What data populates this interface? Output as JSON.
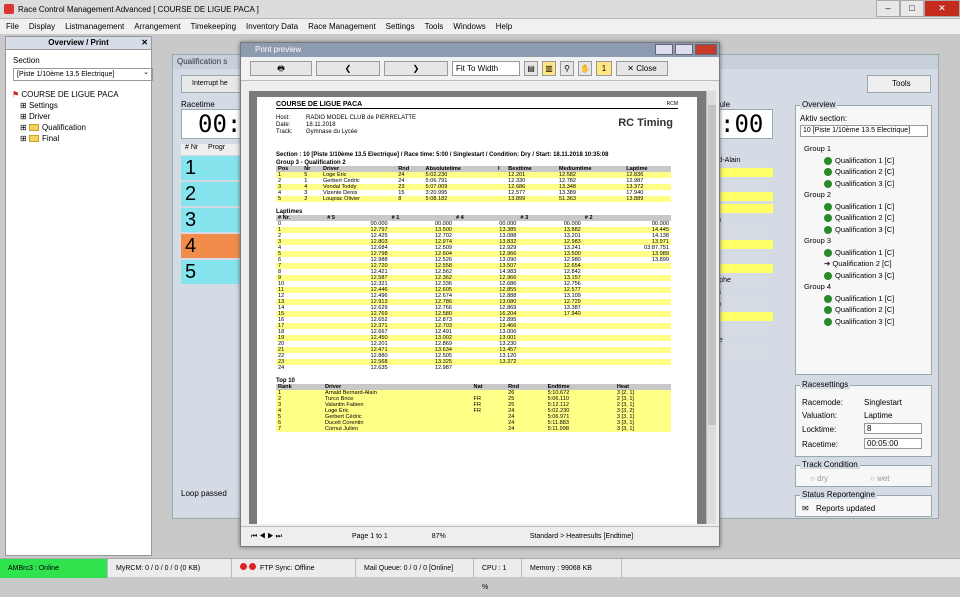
{
  "app": {
    "title": "Race Control Management Advanced [ COURSE DE LIGUE PACA ]"
  },
  "menu": [
    "File",
    "Display",
    "Listmanagement",
    "Arrangement",
    "Timekeeping",
    "Inventory Data",
    "Race Management",
    "Settings",
    "Tools",
    "Windows",
    "Help"
  ],
  "left": {
    "title": "Overview / Print",
    "section_label": "Section",
    "section_value": "[Piste 1/10ème 13.5 Electrique]",
    "tree": [
      "COURSE DE LIGUE PACA",
      "Settings",
      "Driver",
      "Qualification",
      "Final"
    ]
  },
  "bg": {
    "title": "Qualification s",
    "interrupt": "Interrupt he",
    "racetime": "Racetime",
    "racetime_val": "00:0",
    "nr_header": "# Nr",
    "prog_header": "Progr",
    "nums": [
      "1",
      "2",
      "3",
      "4",
      "5"
    ],
    "module_label": "dule",
    "module_val": ":00",
    "loop": "Loop passed",
    "tools": "Tools",
    "names": [
      "rnard-Alain",
      "",
      "bien",
      "",
      "ric",
      "entin",
      "en",
      "vis",
      "nt",
      "dy",
      "ristophe",
      "ques",
      "main",
      "ier",
      "hur",
      "ptiste",
      "mie"
    ]
  },
  "overview": {
    "title": "Overview",
    "aktiv": "Aktiv section:",
    "section": "10 [Piste 1/10ème 13.5 Electrique]",
    "groups": [
      {
        "name": "Group 1",
        "q": [
          "Qualification 1 [C]",
          "Qualification 2 [C]",
          "Qualification 3 [C]"
        ]
      },
      {
        "name": "Group 2",
        "q": [
          "Qualification 1 [C]",
          "Qualification 2 [C]",
          "Qualification 3 [C]"
        ]
      },
      {
        "name": "Group 3",
        "q": [
          "Qualification 1 [C]",
          "Qualification 2 [C]",
          "Qualification 3 [C]"
        ]
      },
      {
        "name": "Group 4",
        "q": [
          "Qualification 1 [C]",
          "Qualification 2 [C]",
          "Qualification 3 [C]"
        ]
      }
    ]
  },
  "racesettings": {
    "title": "Racesettings",
    "racemode_l": "Racemode:",
    "racemode": "Singlestart",
    "valuation_l": "Valuation:",
    "valuation": "Laptime",
    "locktime_l": "Locktime:",
    "locktime": "8",
    "racetime_l": "Racetime:",
    "racetime": "00:05:00"
  },
  "track": {
    "title": "Track Condition",
    "dry": "dry",
    "wet": "wet"
  },
  "report": {
    "title": "Status Reportengine",
    "status": "Reports updated"
  },
  "preview": {
    "title": "Print preview",
    "fit": "Fit To Width",
    "page_num": "1",
    "close": "Close",
    "page_of": "Page 1 to 1",
    "zoom": "87%",
    "status": "Standard > Heatresults [Endtime]"
  },
  "report_page": {
    "header": "COURSE DE LIGUE PACA",
    "host_k": "Host:",
    "host": "RADIO MODEL CLUB de PIERRELATTE",
    "date_k": "Date:",
    "date": "18.11.2018",
    "track_k": "Track:",
    "track": "Gymnase du Lycée",
    "logo": "RC Timing",
    "section_line": "Section : 10 [Piste 1/10ème 13.5 Electrique] / Race time: 5:00 / Singlestart / Condition: Dry / Start: 18.11.2018 10:35:08",
    "group_title": "Group 3 - Qualification 2",
    "res_cols": [
      "Pos",
      "Nr",
      "Driver",
      "Rnd",
      "Absolutetime",
      "I",
      "Besttime",
      "Mediumtime",
      "Laptime"
    ],
    "results": [
      [
        "1",
        "5",
        "Loge Eric",
        "24",
        "5:02.230",
        "",
        "12.201",
        "12.582",
        "12.836"
      ],
      [
        "2",
        "1",
        "Gerbert Cedric",
        "24",
        "5:06.791",
        "",
        "12.330",
        "12.782",
        "12.987"
      ],
      [
        "3",
        "4",
        "Vondal Toddy",
        "23",
        "5:07.009",
        "",
        "12.686",
        "13.348",
        "13.372"
      ],
      [
        "4",
        "3",
        "Vizente Denis",
        "15",
        "3:20.995",
        "",
        "12.577",
        "13.389",
        "17.940"
      ],
      [
        "5",
        "2",
        "Loupiac Olivier",
        "8",
        "5:08.182",
        "",
        "13.899",
        "51.363",
        "13.889"
      ]
    ],
    "lap_title": "Laptimes",
    "lap_cols": [
      "# Nr.",
      "# 5",
      "# 1",
      "# 4",
      "# 3",
      "# 2"
    ],
    "laps": [
      [
        "0",
        "00.000",
        "00.000",
        "00.000",
        "00.000",
        "00.000"
      ],
      [
        "1",
        "12.797",
        "13.500",
        "13.385",
        "13.882",
        "14.445"
      ],
      [
        "2",
        "12.425",
        "12.702",
        "13.088",
        "13.201",
        "14.138"
      ],
      [
        "3",
        "12.803",
        "12.974",
        "13.832",
        "12.983",
        "13.971"
      ],
      [
        "4",
        "12.684",
        "12.509",
        "12.929",
        "13.241",
        "03:87.751"
      ],
      [
        "5",
        "12.798",
        "12.604",
        "12.966",
        "13.500",
        "13.989"
      ],
      [
        "6",
        "12.988",
        "12.526",
        "13.090",
        "12.980",
        "13.899"
      ],
      [
        "7",
        "12.720",
        "12.558",
        "13.507",
        "12.654",
        ""
      ],
      [
        "8",
        "12.421",
        "12.562",
        "14.983",
        "12.842",
        ""
      ],
      [
        "9",
        "12.587",
        "12.362",
        "12.966",
        "13.157",
        ""
      ],
      [
        "10",
        "12.321",
        "12.336",
        "12.686",
        "12.756",
        ""
      ],
      [
        "11",
        "12.446",
        "12.605",
        "12.855",
        "12.577",
        ""
      ],
      [
        "12",
        "12.496",
        "12.674",
        "12.888",
        "13.109",
        ""
      ],
      [
        "13",
        "12.913",
        "12.786",
        "13.080",
        "12.729",
        ""
      ],
      [
        "14",
        "12.629",
        "12.766",
        "12.869",
        "13.387",
        ""
      ],
      [
        "15",
        "12.769",
        "12.580",
        "16.204",
        "17.940",
        ""
      ],
      [
        "16",
        "12.652",
        "12.873",
        "12.895",
        "",
        ""
      ],
      [
        "17",
        "12.371",
        "12.703",
        "13.466",
        "",
        ""
      ],
      [
        "18",
        "12.667",
        "12.491",
        "13.006",
        "",
        ""
      ],
      [
        "19",
        "12.450",
        "13.002",
        "13.001",
        "",
        ""
      ],
      [
        "20",
        "12.201",
        "12.869",
        "13.230",
        "",
        ""
      ],
      [
        "21",
        "12.471",
        "13.634",
        "13.457",
        "",
        ""
      ],
      [
        "22",
        "12.880",
        "12.505",
        "13.120",
        "",
        ""
      ],
      [
        "23",
        "12.568",
        "13.325",
        "13.372",
        "",
        ""
      ],
      [
        "24",
        "12.635",
        "12.987",
        "",
        "",
        ""
      ]
    ],
    "top_title": "Top 10",
    "top_cols": [
      "Rank",
      "Driver",
      "Nat",
      "Rnd",
      "Endtime",
      "Heat"
    ],
    "top": [
      [
        "1",
        "Arnald Bernard-Alain",
        "",
        "26",
        "5:10.672",
        "3 [2, 1]"
      ],
      [
        "2",
        "Turco Brice",
        "FR",
        "25",
        "5:06.110",
        "2 [3, 1]"
      ],
      [
        "3",
        "Valantin Fabien",
        "FR",
        "25",
        "5:12.112",
        "2 [3, 1]"
      ],
      [
        "4",
        "Loge Eric",
        "FR",
        "24",
        "5:02.230",
        "3 [3, 2]"
      ],
      [
        "5",
        "Gerbert Cédric",
        "",
        "24",
        "5:06.971",
        "3 [3, 1]"
      ],
      [
        "6",
        "Duceit Corentin",
        "",
        "24",
        "5:11.883",
        "3 [3, 1]"
      ],
      [
        "7",
        "Cornut Julien",
        "",
        "24",
        "5:11.998",
        "3 [3, 1]"
      ]
    ]
  },
  "status": {
    "ambrc": "AMBrc3 : Online",
    "myrcm": "MyRCM: 0 / 0 / 0 / 0 (0 KB)",
    "ftp": "FTP Sync: Offline",
    "mailq": "Mail Queue: 0 / 0 / 0 [Online]",
    "cpu": "CPU : 1 %",
    "memory": "Memory : 99068 KB"
  }
}
